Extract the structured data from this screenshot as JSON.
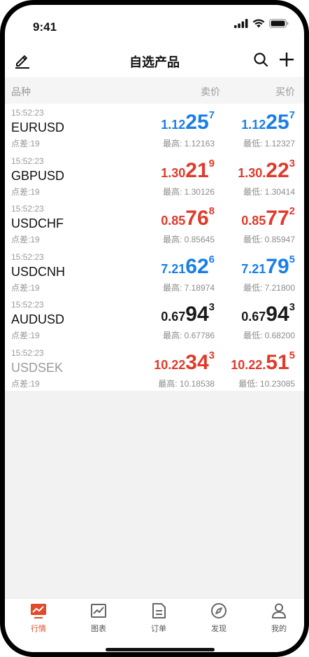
{
  "status": {
    "time": "9:41"
  },
  "nav": {
    "title": "自选产品"
  },
  "columns": {
    "name": "品种",
    "sell": "卖价",
    "buy": "买价"
  },
  "colors": {
    "blue": "#1a7ee8",
    "red": "#e03a2b",
    "black": "#1a1a1a",
    "accent": "#e04b2a"
  },
  "quotes": [
    {
      "time": "15:52:23",
      "symbol": "EURUSD",
      "spread": "点差:19",
      "sell": {
        "pre": "1.12",
        "big": "25",
        "sup": "7",
        "color": "blue"
      },
      "buy": {
        "pre": "1.12",
        "big": "25",
        "sup": "7",
        "color": "blue"
      },
      "high": "最高: 1.12163",
      "low": "最低: 1.12327"
    },
    {
      "time": "15:52:23",
      "symbol": "GBPUSD",
      "spread": "点差:19",
      "sell": {
        "pre": "1.30",
        "big": "21",
        "sup": "9",
        "color": "red"
      },
      "buy": {
        "pre": "1.30.",
        "big": "22",
        "sup": "3",
        "color": "red"
      },
      "high": "最高: 1.30126",
      "low": "最低: 1.30414"
    },
    {
      "time": "15:52:23",
      "symbol": "USDCHF",
      "spread": "点差:19",
      "sell": {
        "pre": "0.85",
        "big": "76",
        "sup": "8",
        "color": "red"
      },
      "buy": {
        "pre": "0.85",
        "big": "77",
        "sup": "2",
        "color": "red"
      },
      "high": "最高: 0.85645",
      "low": "最低: 0.85947"
    },
    {
      "time": "15:52:23",
      "symbol": "USDCNH",
      "spread": "点差:19",
      "sell": {
        "pre": "7.21",
        "big": "62",
        "sup": "6",
        "color": "blue"
      },
      "buy": {
        "pre": "7.21",
        "big": "79",
        "sup": "5",
        "color": "blue"
      },
      "high": "最高: 7.18974",
      "low": "最低: 7.21800"
    },
    {
      "time": "15:52:23",
      "symbol": "AUDUSD",
      "spread": "点差:19",
      "sell": {
        "pre": "0.67",
        "big": "94",
        "sup": "3",
        "color": "black"
      },
      "buy": {
        "pre": "0.67",
        "big": "94",
        "sup": "3",
        "color": "black"
      },
      "high": "最高: 0.67786",
      "low": "最低: 0.68200"
    },
    {
      "time": "15:52:23",
      "symbol": "USDSEK",
      "spread": "点差:19",
      "sell": {
        "pre": "10.22",
        "big": "34",
        "sup": "3",
        "color": "red"
      },
      "buy": {
        "pre": "10.22.",
        "big": "51",
        "sup": "5",
        "color": "red"
      },
      "high": "最高: 10.18538",
      "low": "最低: 10.23085"
    }
  ],
  "tabs": [
    {
      "label": "行情",
      "icon": "market-monitor-icon",
      "active": true
    },
    {
      "label": "图表",
      "icon": "chart-icon",
      "active": false
    },
    {
      "label": "订单",
      "icon": "order-document-icon",
      "active": false
    },
    {
      "label": "发现",
      "icon": "compass-icon",
      "active": false
    },
    {
      "label": "我的",
      "icon": "profile-icon",
      "active": false
    }
  ]
}
